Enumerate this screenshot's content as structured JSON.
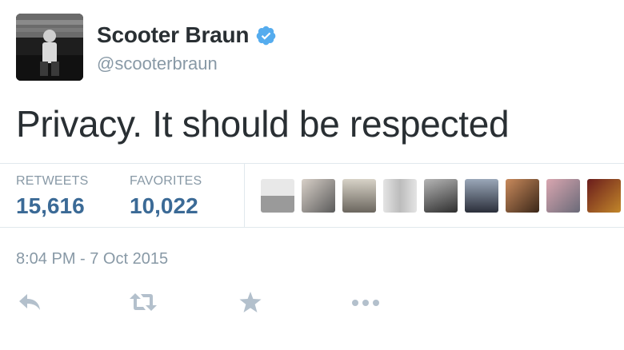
{
  "tweet": {
    "display_name": "Scooter Braun",
    "handle": "@scooterbraun",
    "verified": true,
    "text": "Privacy. It should be respected",
    "timestamp": "8:04 PM - 7 Oct 2015"
  },
  "stats": {
    "retweets_label": "RETWEETS",
    "retweets_value": "15,616",
    "favorites_label": "FAVORITES",
    "favorites_value": "10,022"
  },
  "icons": {
    "verified": "verified-badge-icon",
    "reply": "reply-icon",
    "retweet": "retweet-icon",
    "favorite": "star-icon",
    "more": "more-dots-icon"
  },
  "colors": {
    "accent": "#55acee",
    "stat_value": "#3b6a96",
    "muted": "#8899a6",
    "action_icon": "#b3c0cc"
  }
}
